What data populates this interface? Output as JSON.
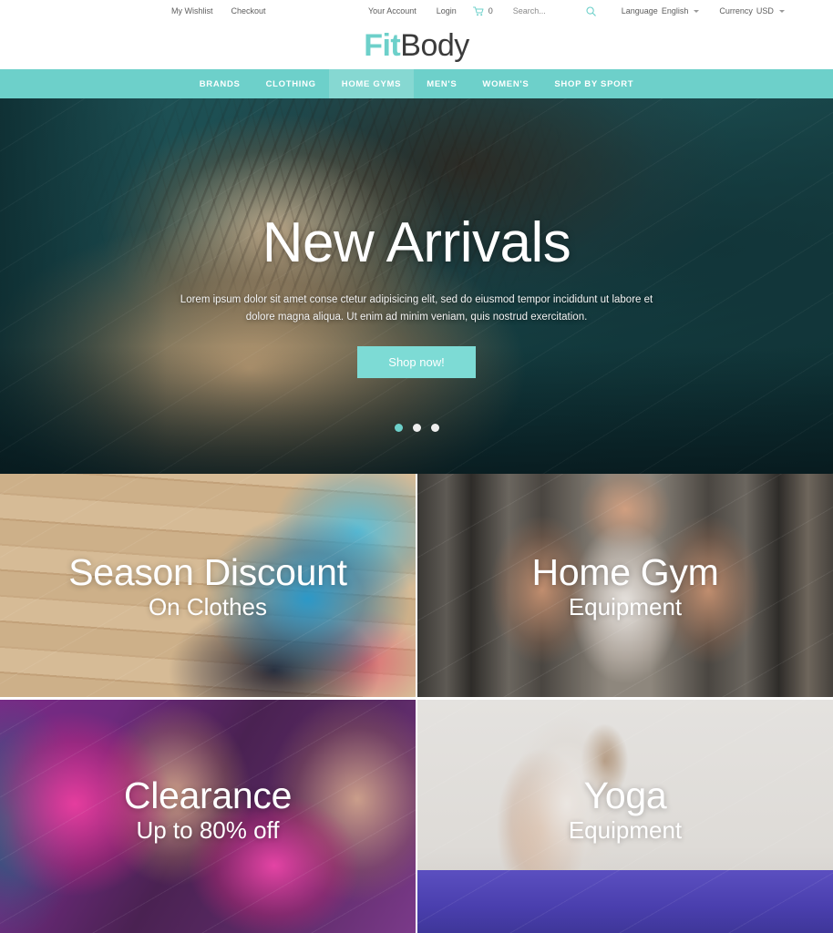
{
  "topbar": {
    "left_links": [
      {
        "label": "My Wishlist",
        "name": "my-wishlist-link"
      },
      {
        "label": "Checkout",
        "name": "checkout-link"
      }
    ],
    "account_label": "Your Account",
    "login_label": "Login",
    "cart_count": "0",
    "cart_icon": "shopping-cart-icon",
    "search_placeholder": "Search...",
    "search_value": "",
    "search_icon": "search-icon",
    "language_label": "Language",
    "language_value": "English",
    "currency_label": "Currency",
    "currency_value": "USD"
  },
  "logo": {
    "part_one": "Fit",
    "part_two": "Body",
    "accent_color": "#6dd0ca",
    "text_color": "#3b3b3b"
  },
  "nav": {
    "background": "#6dd0ca",
    "active_background": "#86d8d2",
    "items": [
      {
        "label": "BRANDS",
        "active": false
      },
      {
        "label": "CLOTHING",
        "active": false
      },
      {
        "label": "HOME GYMS",
        "active": true
      },
      {
        "label": "MEN'S",
        "active": false
      },
      {
        "label": "WOMEN'S",
        "active": false
      },
      {
        "label": "SHOP BY SPORT",
        "active": false
      }
    ]
  },
  "hero": {
    "title": "New Arrivals",
    "subtitle": "Lorem ipsum dolor sit amet conse ctetur adipisicing elit, sed do eiusmod tempor incididunt ut labore et dolore magna aliqua. Ut enim ad minim veniam, quis nostrud exercitation.",
    "button_label": "Shop now!",
    "button_color": "#7ddbd5",
    "slides": 3,
    "active_slide": 1,
    "active_dot_color": "#6dd0ca",
    "inactive_dot_color": "#eeeeee"
  },
  "promos": [
    {
      "title": "Season Discount",
      "subtitle": "On Clothes",
      "name": "promo-season-discount"
    },
    {
      "title": "Home Gym",
      "subtitle": "Equipment",
      "name": "promo-home-gym"
    },
    {
      "title": "Clearance",
      "subtitle": "Up to 80% off",
      "name": "promo-clearance"
    },
    {
      "title": "Yoga",
      "subtitle": "Equipment",
      "name": "promo-yoga"
    }
  ]
}
